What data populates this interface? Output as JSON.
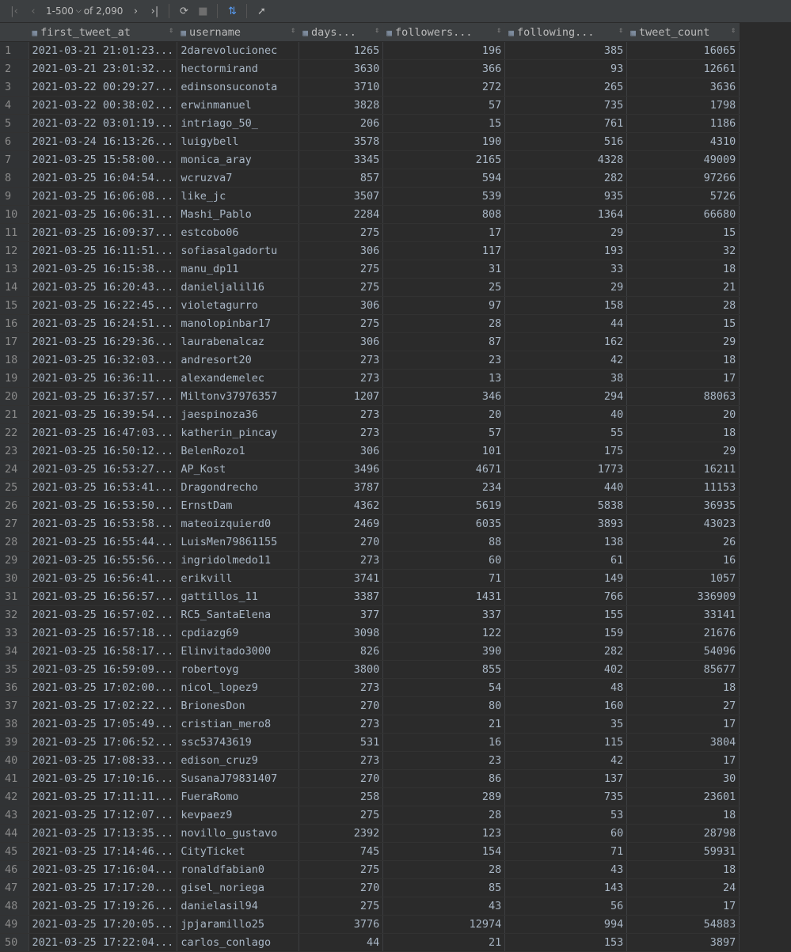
{
  "toolbar": {
    "first_icon": "first-page-icon",
    "prev_icon": "prev-page-icon",
    "range_label": "1-500",
    "of_label": "of 2,090",
    "next_icon": "next-page-icon",
    "last_icon": "last-page-icon",
    "refresh_icon": "refresh-icon",
    "stop_icon": "stop-icon",
    "compare_icon": "compare-icon",
    "pin_icon": "pin-icon"
  },
  "columns": [
    "first_tweet_at",
    "username",
    "days...",
    "followers...",
    "following...",
    "tweet_count"
  ],
  "rows": [
    [
      "1",
      "2021-03-21 21:01:23...",
      "2darevolucionec",
      "1265",
      "196",
      "385",
      "16065"
    ],
    [
      "2",
      "2021-03-21 23:01:32...",
      "hectormirand",
      "3630",
      "366",
      "93",
      "12661"
    ],
    [
      "3",
      "2021-03-22 00:29:27...",
      "edinsonsuconota",
      "3710",
      "272",
      "265",
      "3636"
    ],
    [
      "4",
      "2021-03-22 00:38:02...",
      "erwinmanuel",
      "3828",
      "57",
      "735",
      "1798"
    ],
    [
      "5",
      "2021-03-22 03:01:19...",
      "intriago_50_",
      "206",
      "15",
      "761",
      "1186"
    ],
    [
      "6",
      "2021-03-24 16:13:26...",
      "luigybell",
      "3578",
      "190",
      "516",
      "4310"
    ],
    [
      "7",
      "2021-03-25 15:58:00...",
      "monica_aray",
      "3345",
      "2165",
      "4328",
      "49009"
    ],
    [
      "8",
      "2021-03-25 16:04:54...",
      "wcruzva7",
      "857",
      "594",
      "282",
      "97266"
    ],
    [
      "9",
      "2021-03-25 16:06:08...",
      "like_jc",
      "3507",
      "539",
      "935",
      "5726"
    ],
    [
      "10",
      "2021-03-25 16:06:31...",
      "Mashi_Pablo",
      "2284",
      "808",
      "1364",
      "66680"
    ],
    [
      "11",
      "2021-03-25 16:09:37...",
      "estcobo06",
      "275",
      "17",
      "29",
      "15"
    ],
    [
      "12",
      "2021-03-25 16:11:51...",
      "sofiasalgadortu",
      "306",
      "117",
      "193",
      "32"
    ],
    [
      "13",
      "2021-03-25 16:15:38...",
      "manu_dp11",
      "275",
      "31",
      "33",
      "18"
    ],
    [
      "14",
      "2021-03-25 16:20:43...",
      "danieljalil16",
      "275",
      "25",
      "29",
      "21"
    ],
    [
      "15",
      "2021-03-25 16:22:45...",
      "violetagurro",
      "306",
      "97",
      "158",
      "28"
    ],
    [
      "16",
      "2021-03-25 16:24:51...",
      "manolopinbar17",
      "275",
      "28",
      "44",
      "15"
    ],
    [
      "17",
      "2021-03-25 16:29:36...",
      "laurabenalcaz",
      "306",
      "87",
      "162",
      "29"
    ],
    [
      "18",
      "2021-03-25 16:32:03...",
      "andresort20",
      "273",
      "23",
      "42",
      "18"
    ],
    [
      "19",
      "2021-03-25 16:36:11...",
      "alexandemelec",
      "273",
      "13",
      "38",
      "17"
    ],
    [
      "20",
      "2021-03-25 16:37:57...",
      "Miltonv37976357",
      "1207",
      "346",
      "294",
      "88063"
    ],
    [
      "21",
      "2021-03-25 16:39:54...",
      "jaespinoza36",
      "273",
      "20",
      "40",
      "20"
    ],
    [
      "22",
      "2021-03-25 16:47:03...",
      "katherin_pincay",
      "273",
      "57",
      "55",
      "18"
    ],
    [
      "23",
      "2021-03-25 16:50:12...",
      "BelenRozo1",
      "306",
      "101",
      "175",
      "29"
    ],
    [
      "24",
      "2021-03-25 16:53:27...",
      "AP_Kost",
      "3496",
      "4671",
      "1773",
      "16211"
    ],
    [
      "25",
      "2021-03-25 16:53:41...",
      "Dragondrecho",
      "3787",
      "234",
      "440",
      "11153"
    ],
    [
      "26",
      "2021-03-25 16:53:50...",
      "ErnstDam",
      "4362",
      "5619",
      "5838",
      "36935"
    ],
    [
      "27",
      "2021-03-25 16:53:58...",
      "mateoizquierd0",
      "2469",
      "6035",
      "3893",
      "43023"
    ],
    [
      "28",
      "2021-03-25 16:55:44...",
      "LuisMen79861155",
      "270",
      "88",
      "138",
      "26"
    ],
    [
      "29",
      "2021-03-25 16:55:56...",
      "ingridolmedo11",
      "273",
      "60",
      "61",
      "16"
    ],
    [
      "30",
      "2021-03-25 16:56:41...",
      "erikvill",
      "3741",
      "71",
      "149",
      "1057"
    ],
    [
      "31",
      "2021-03-25 16:56:57...",
      "gattillos_11",
      "3387",
      "1431",
      "766",
      "336909"
    ],
    [
      "32",
      "2021-03-25 16:57:02...",
      "RC5_SantaElena",
      "377",
      "337",
      "155",
      "33141"
    ],
    [
      "33",
      "2021-03-25 16:57:18...",
      "cpdiazg69",
      "3098",
      "122",
      "159",
      "21676"
    ],
    [
      "34",
      "2021-03-25 16:58:17...",
      "Elinvitado3000",
      "826",
      "390",
      "282",
      "54096"
    ],
    [
      "35",
      "2021-03-25 16:59:09...",
      "robertoyg",
      "3800",
      "855",
      "402",
      "85677"
    ],
    [
      "36",
      "2021-03-25 17:02:00...",
      "nicol_lopez9",
      "273",
      "54",
      "48",
      "18"
    ],
    [
      "37",
      "2021-03-25 17:02:22...",
      "BrionesDon",
      "270",
      "80",
      "160",
      "27"
    ],
    [
      "38",
      "2021-03-25 17:05:49...",
      "cristian_mero8",
      "273",
      "21",
      "35",
      "17"
    ],
    [
      "39",
      "2021-03-25 17:06:52...",
      "ssc53743619",
      "531",
      "16",
      "115",
      "3804"
    ],
    [
      "40",
      "2021-03-25 17:08:33...",
      "edison_cruz9",
      "273",
      "23",
      "42",
      "17"
    ],
    [
      "41",
      "2021-03-25 17:10:16...",
      "SusanaJ79831407",
      "270",
      "86",
      "137",
      "30"
    ],
    [
      "42",
      "2021-03-25 17:11:11...",
      "FueraRomo",
      "258",
      "289",
      "735",
      "23601"
    ],
    [
      "43",
      "2021-03-25 17:12:07...",
      "kevpaez9",
      "275",
      "28",
      "53",
      "18"
    ],
    [
      "44",
      "2021-03-25 17:13:35...",
      "novillo_gustavo",
      "2392",
      "123",
      "60",
      "28798"
    ],
    [
      "45",
      "2021-03-25 17:14:46...",
      "CityTicket",
      "745",
      "154",
      "71",
      "59931"
    ],
    [
      "46",
      "2021-03-25 17:16:04...",
      "ronaldfabian0",
      "275",
      "28",
      "43",
      "18"
    ],
    [
      "47",
      "2021-03-25 17:17:20...",
      "gisel_noriega",
      "270",
      "85",
      "143",
      "24"
    ],
    [
      "48",
      "2021-03-25 17:19:26...",
      "danielasil94",
      "275",
      "43",
      "56",
      "17"
    ],
    [
      "49",
      "2021-03-25 17:20:05...",
      "jpjaramillo25",
      "3776",
      "12974",
      "994",
      "54883"
    ],
    [
      "50",
      "2021-03-25 17:22:04...",
      "carlos_conlago",
      "44",
      "21",
      "153",
      "3897"
    ]
  ]
}
